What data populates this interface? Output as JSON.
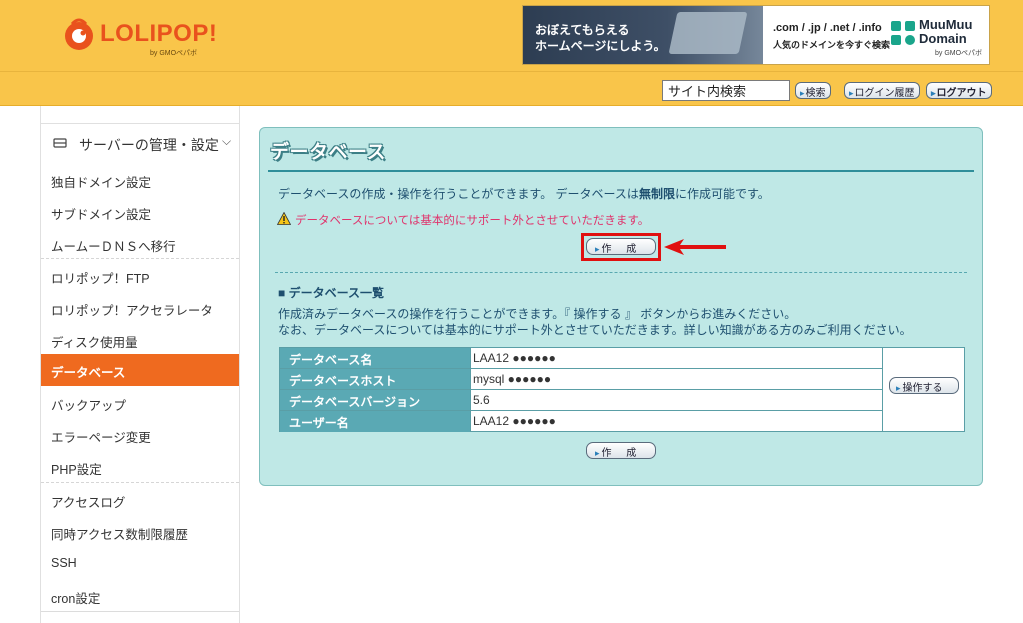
{
  "header": {
    "logo_text": "LOLIPOP!",
    "logo_sub": "by GMOペパボ",
    "banner": {
      "line1": "おぼえてもらえる",
      "line2": "ホームページにしよう。",
      "tlds": ".com / .jp / .net / .info",
      "tagline": "人気のドメインを今すぐ検索",
      "brand": "MuuMuu Domain",
      "brand_sub": "by GMOペパボ"
    },
    "search_placeholder": "サイト内検索",
    "search_button": "検索",
    "login_history_button": "ログイン履歴",
    "logout_button": "ログアウト"
  },
  "sidebar": {
    "section_label": "サーバーの管理・設定",
    "items": [
      {
        "label": "独自ドメイン設定"
      },
      {
        "label": "サブドメイン設定"
      },
      {
        "label": "ムームーＤＮＳへ移行"
      },
      {
        "label": "ロリポップ！FTP"
      },
      {
        "label": "ロリポップ！アクセラレータ"
      },
      {
        "label": "ディスク使用量"
      },
      {
        "label": "データベース",
        "active": true
      },
      {
        "label": "バックアップ"
      },
      {
        "label": "エラーページ変更"
      },
      {
        "label": "PHP設定"
      },
      {
        "label": "アクセスログ"
      },
      {
        "label": "同時アクセス数制限履歴"
      },
      {
        "label": "SSH"
      },
      {
        "label": "cron設定"
      }
    ]
  },
  "main": {
    "title": "データベース",
    "intro_prefix": "データベースの作成・操作を行うことができます。 データベースは",
    "intro_bold": "無制限",
    "intro_suffix": "に作成可能です。",
    "warning": "データベースについては基本的にサポート外とさせていただきます。",
    "create_button": "作 成",
    "list_heading": "■ データベース一覧",
    "list_desc1": "作成済みデータベースの操作を行うことができます。『 操作する 』 ボタンからお進みください。",
    "list_desc2": "なお、データベースについては基本的にサポート外とさせていただきます。詳しい知識がある方のみご利用ください。",
    "table": {
      "rows": [
        {
          "label": "データベース名",
          "value": "LAA12 ●●●●●●"
        },
        {
          "label": "データベースホスト",
          "value": "mysql ●●●●●●"
        },
        {
          "label": "データベースバージョン",
          "value": "5.6"
        },
        {
          "label": "ユーザー名",
          "value": "LAA12 ●●●●●●"
        }
      ],
      "action_button": "操作する"
    }
  },
  "colors": {
    "header_bg": "#f9c54a",
    "active_item": "#ef6a1f",
    "panel_bg": "#bfe8e6",
    "table_label_bg": "#5aa9b4",
    "warning_text": "#e0336c",
    "highlight": "#e01010"
  }
}
